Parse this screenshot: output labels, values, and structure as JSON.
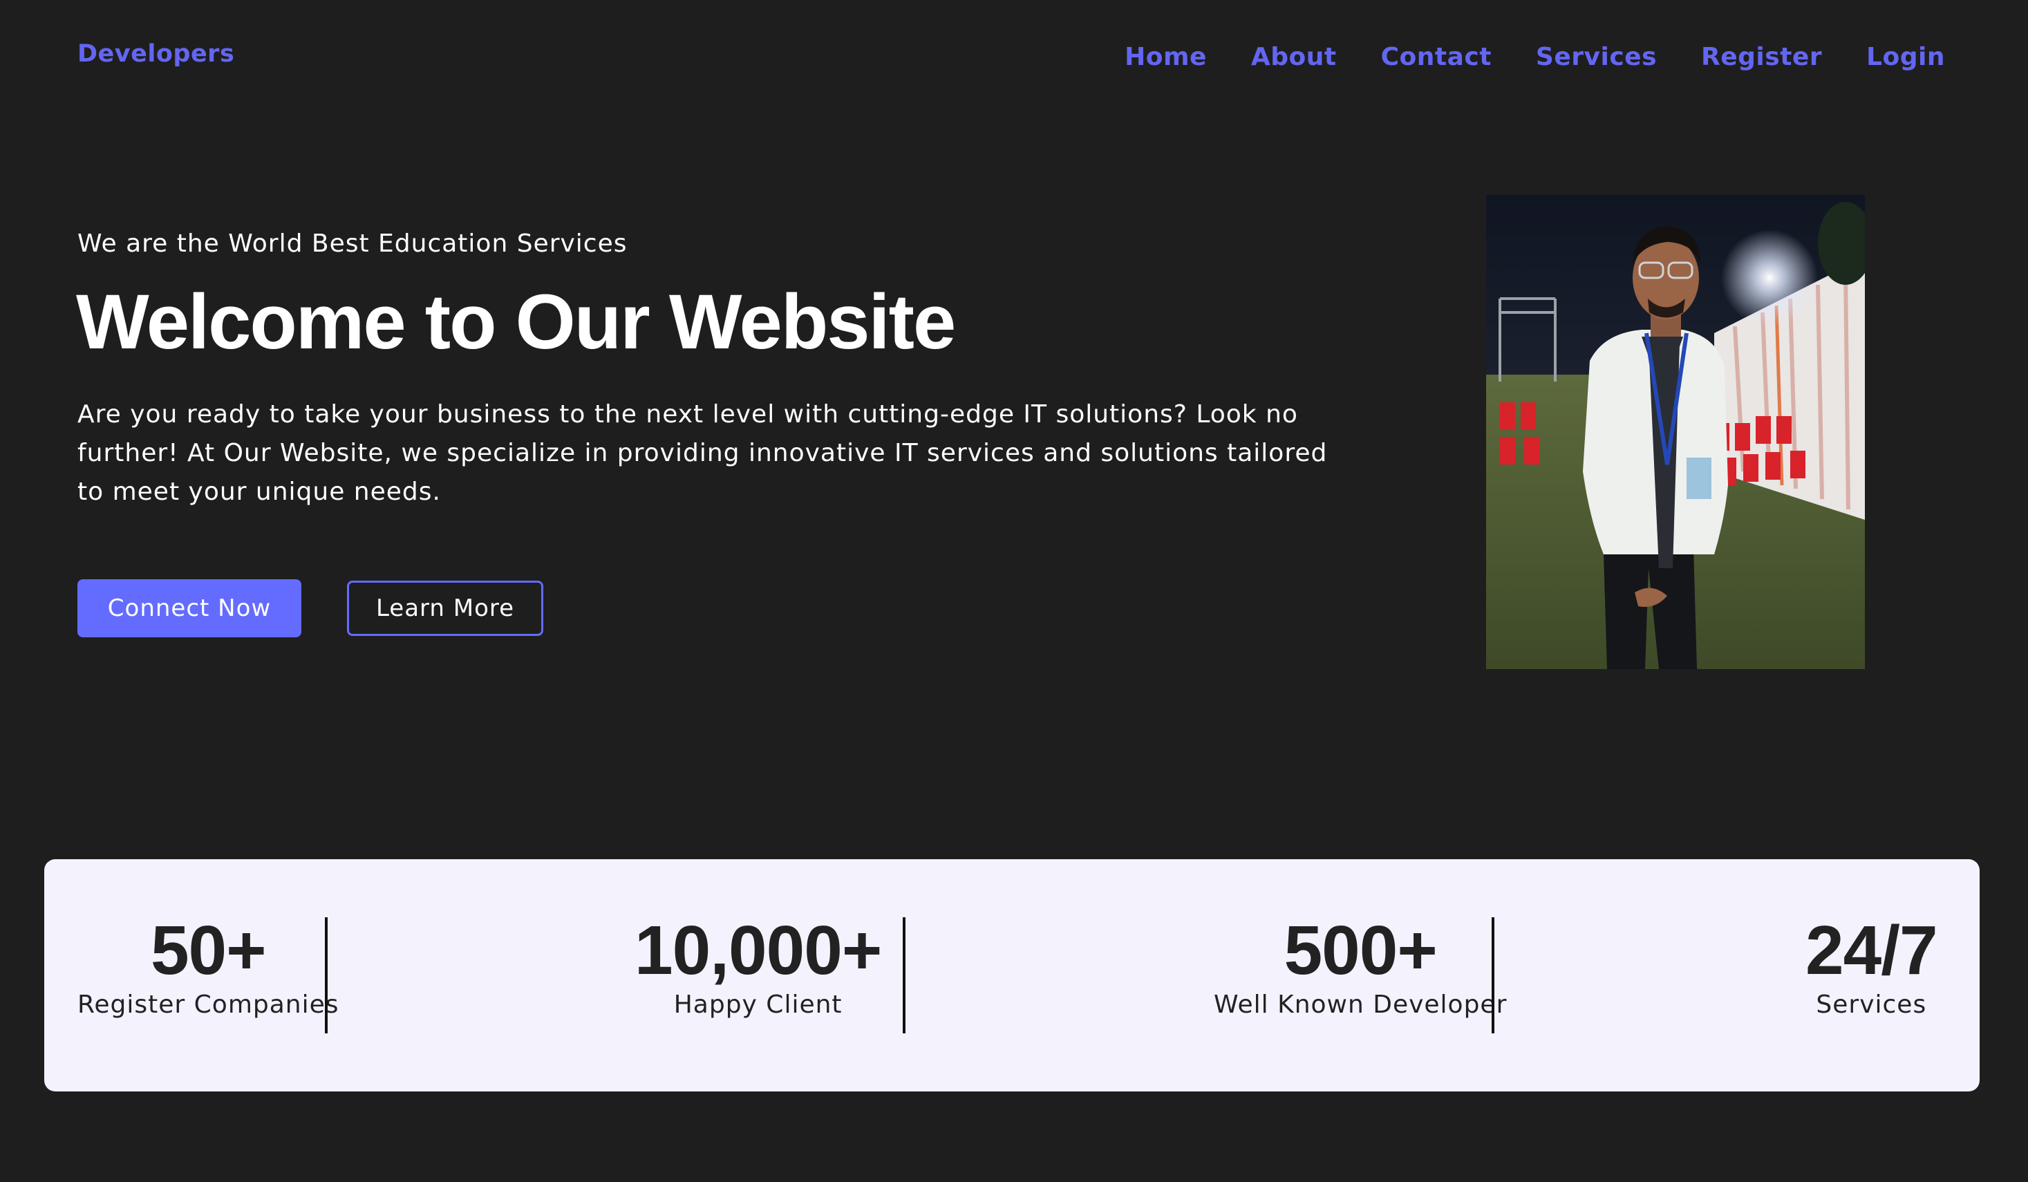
{
  "header": {
    "logo": "Developers",
    "nav": [
      "Home",
      "About",
      "Contact",
      "Services",
      "Register",
      "Login"
    ]
  },
  "hero": {
    "subtitle": "We are the World Best Education Services",
    "title": "Welcome to Our Website",
    "description": "Are you ready to take your business to the next level with cutting-edge IT solutions? Look no further! At Our Website, we specialize in providing innovative IT services and solutions tailored to meet your unique needs.",
    "primary_button": "Connect Now",
    "secondary_button": "Learn More",
    "image_alt": "photo of a developer"
  },
  "stats": [
    {
      "value": "50+",
      "label": "Register Companies"
    },
    {
      "value": "10,000+",
      "label": "Happy Client"
    },
    {
      "value": "500+",
      "label": "Well Known Developer"
    },
    {
      "value": "24/7",
      "label": "Services"
    }
  ],
  "colors": {
    "background": "#1e1e1f",
    "accent": "#646cff",
    "stats_background": "#f4f2fd"
  }
}
